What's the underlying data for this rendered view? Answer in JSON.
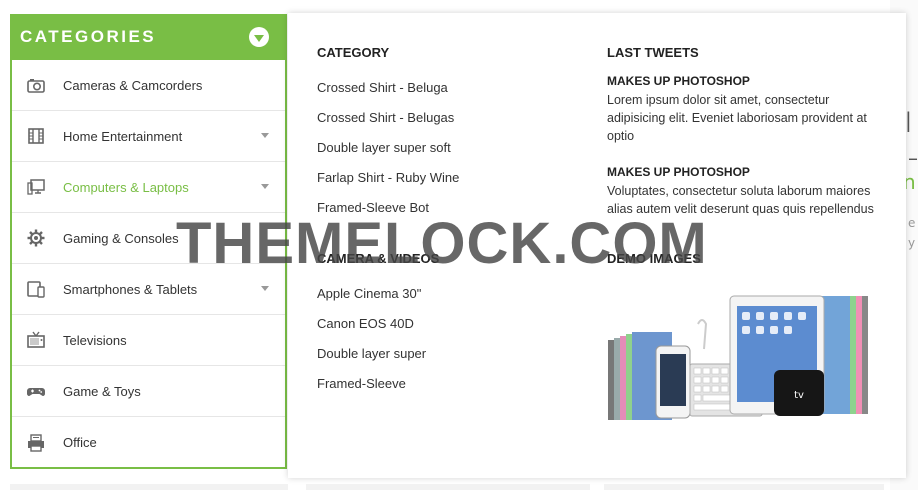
{
  "sidebar": {
    "title": "CATEGORIES",
    "items": [
      {
        "label": "Cameras & Camcorders",
        "icon": "camera-icon",
        "has_submenu": false,
        "active": false
      },
      {
        "label": "Home Entertainment",
        "icon": "film-icon",
        "has_submenu": true,
        "active": false
      },
      {
        "label": "Computers & Laptops",
        "icon": "computer-icon",
        "has_submenu": true,
        "active": true
      },
      {
        "label": "Gaming & Consoles",
        "icon": "gear-icon",
        "has_submenu": false,
        "active": false
      },
      {
        "label": "Smartphones & Tablets",
        "icon": "tablet-icon",
        "has_submenu": true,
        "active": false
      },
      {
        "label": "Televisions",
        "icon": "tv-icon",
        "has_submenu": false,
        "active": false
      },
      {
        "label": "Game & Toys",
        "icon": "gamepad-icon",
        "has_submenu": false,
        "active": false
      },
      {
        "label": "Office",
        "icon": "printer-icon",
        "has_submenu": false,
        "active": false
      }
    ]
  },
  "mega_menu": {
    "category": {
      "title": "CATEGORY",
      "links": [
        "Crossed Shirt - Beluga",
        "Crossed Shirt - Belugas",
        "Double layer super soft",
        "Farlap Shirt - Ruby Wine",
        "Framed-Sleeve Bot"
      ]
    },
    "camera_videos": {
      "title": "CAMERA & VIDEOS",
      "links": [
        "Apple Cinema 30\"",
        "Canon EOS 40D",
        "Double layer super",
        "Framed-Sleeve"
      ]
    },
    "last_tweets": {
      "title": "LAST TWEETS",
      "tweets": [
        {
          "title": "MAKES UP PHOTOSHOP",
          "body": "Lorem ipsum dolor sit amet, consectetur adipisicing elit. Eveniet laboriosam provident at optio"
        },
        {
          "title": "MAKES UP PHOTOSHOP",
          "body": "Voluptates, consectetur soluta laborum maiores alias autem velit deserunt quas quis repellendus"
        }
      ]
    },
    "demo_images": {
      "title": "DEMO IMAGES",
      "tv_label": "tv"
    }
  },
  "watermark": "THEMELOCK.COM",
  "colors": {
    "accent": "#79be45",
    "text": "#333333",
    "border": "#e6e6e6"
  }
}
